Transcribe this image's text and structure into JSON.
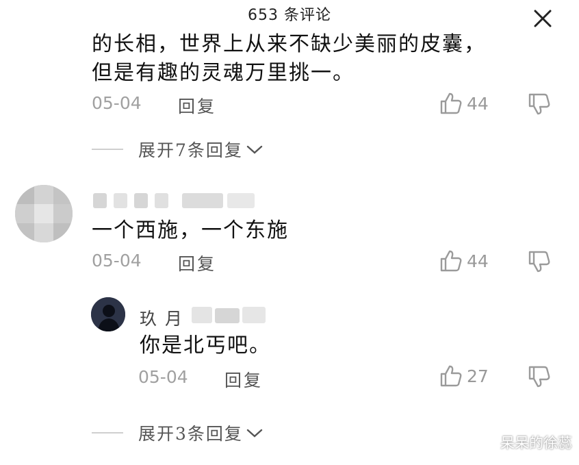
{
  "header": {
    "title": "653 条评论"
  },
  "comment1": {
    "text_line1": "的长相，世界上从来不缺少美丽的皮囊，",
    "text_line2": "但是有趣的灵魂万里挑一。",
    "date": "05-04",
    "reply_label": "回复",
    "likes": "44"
  },
  "expand1": {
    "label": "展开7条回复"
  },
  "comment2": {
    "text": "一个西施，一个东施",
    "date": "05-04",
    "reply_label": "回复",
    "likes": "44"
  },
  "reply1": {
    "username": "玖月",
    "text": "你是北丐吧。",
    "date": "05-04",
    "reply_label": "回复",
    "likes": "27"
  },
  "expand2": {
    "label": "展开3条回复"
  },
  "watermark": "呆呆的徐蕊",
  "icons": {
    "close": "close-icon",
    "like": "thumbs-up-icon",
    "dislike": "thumbs-down-icon",
    "chevron": "chevron-down-icon"
  },
  "colors": {
    "text": "#111111",
    "muted": "#a0a0a0",
    "avatar_dark": "#2c3347"
  }
}
